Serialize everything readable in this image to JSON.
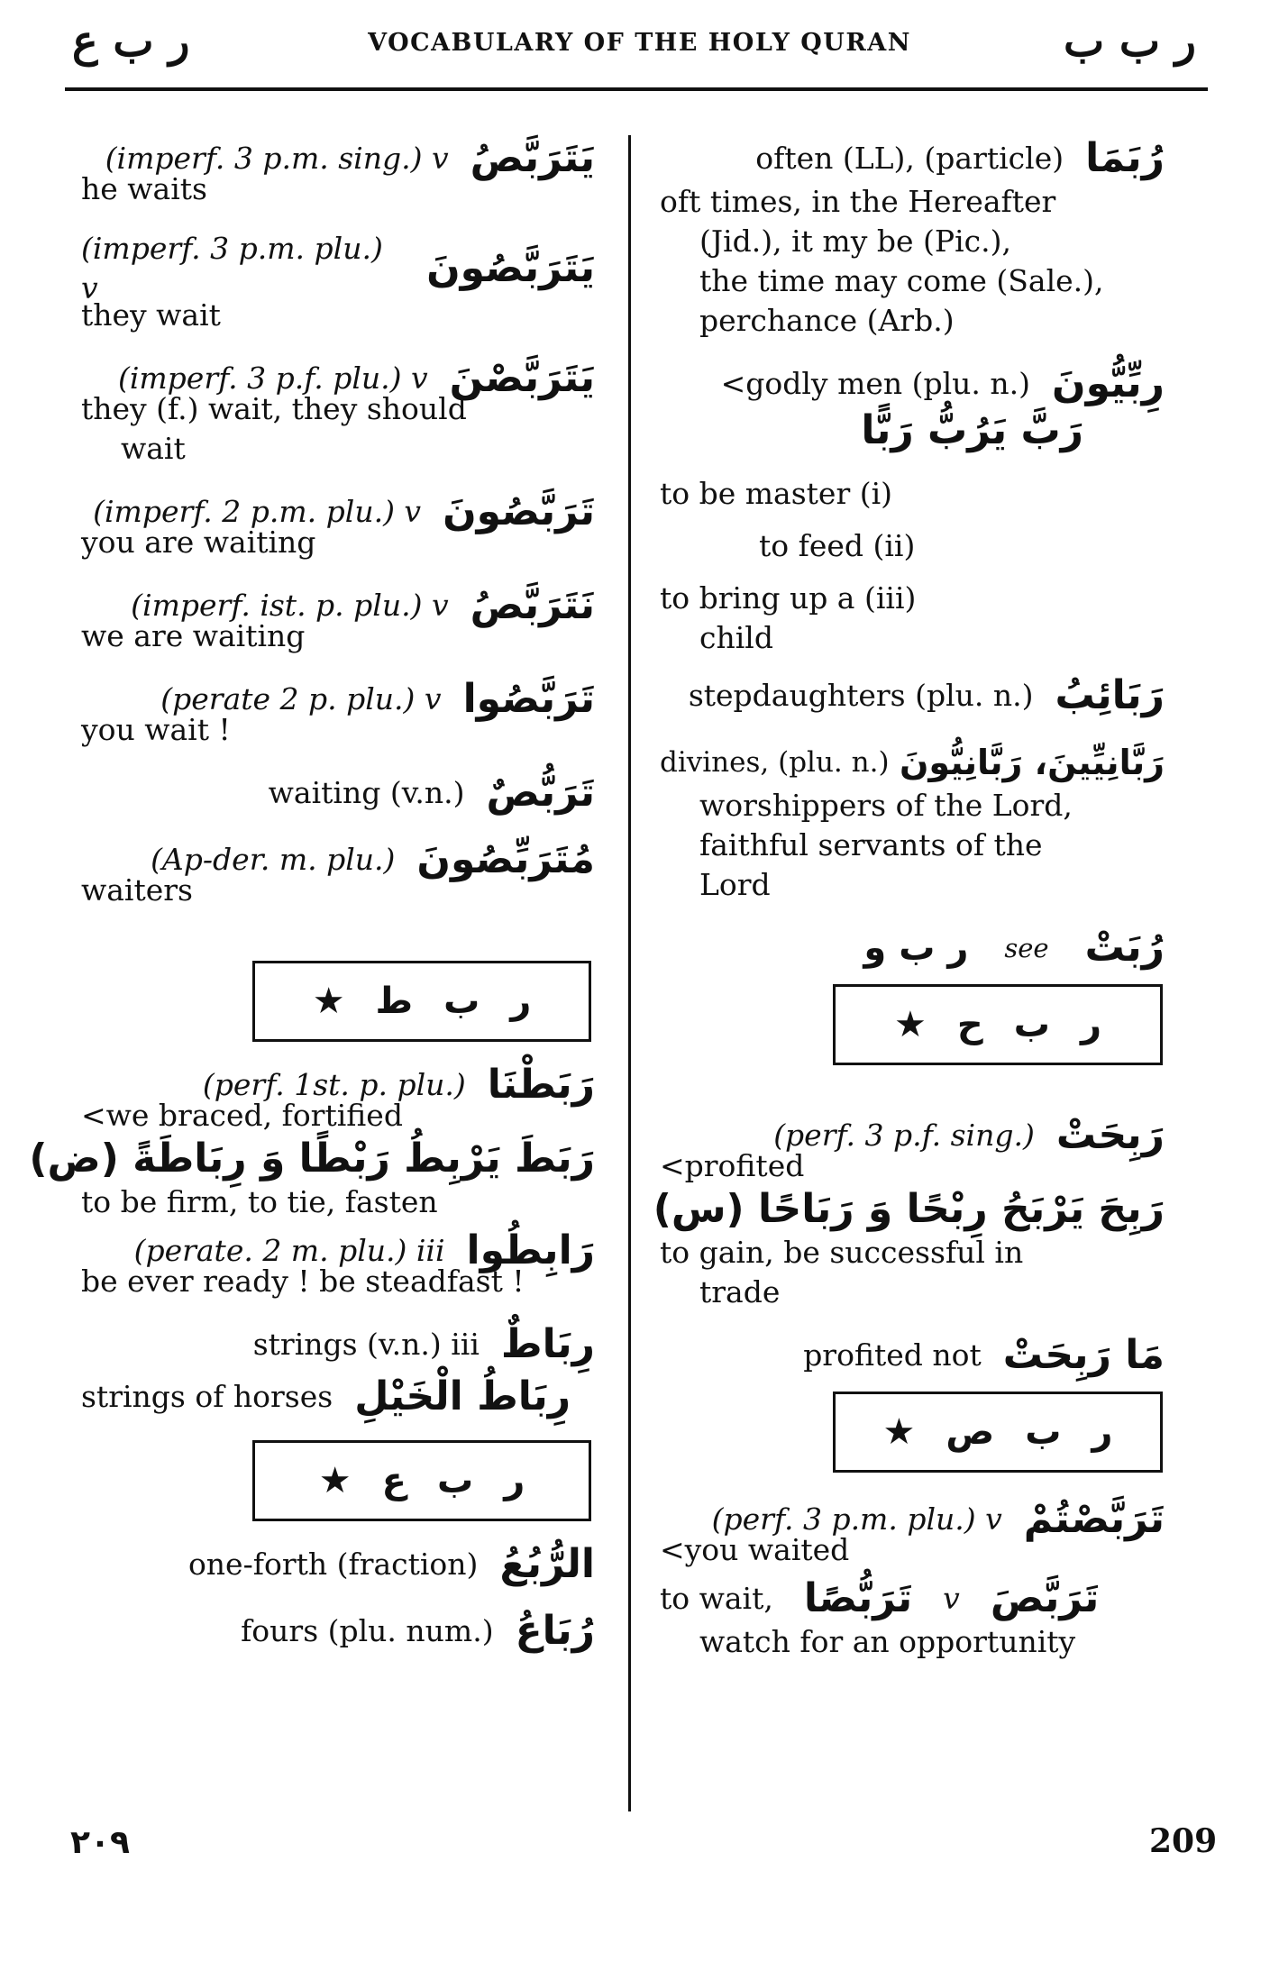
{
  "header": {
    "left_arabic": "ر ب ع",
    "title": "VOCABULARY OF THE HOLY QURAN",
    "right_arabic": "ر ب ب"
  },
  "left_column": {
    "entries": [
      {
        "ar": "يَتَرَبَّصُ",
        "gram": "(imperf. 3 p.m. sing.) v",
        "en": "he waits"
      },
      {
        "ar": "يَتَرَبَّصُونَ",
        "gram": "(imperf. 3 p.m. plu.) v",
        "en": "they wait"
      },
      {
        "ar": "يَتَرَبَّصْنَ",
        "gram": "(imperf. 3 p.f. plu.) v",
        "en": "they (f.) wait, they should",
        "en_cont": "wait"
      },
      {
        "ar": "تَرَبَّصُونَ",
        "gram": "(imperf. 2 p.m. plu.) v",
        "en": "you are waiting"
      },
      {
        "ar": "نَتَرَبَّصُ",
        "gram": "(imperf. ist. p. plu.) v",
        "en": "we are waiting"
      },
      {
        "ar": "تَرَبَّصُوا",
        "gram": "(perate 2 p. plu.) v",
        "en": "you wait !"
      },
      {
        "ar": "تَرَبُّصٌ",
        "gram": "waiting (v.n.)",
        "en": ""
      },
      {
        "ar": "مُتَرَبِّصُونَ",
        "gram": "(Ap-der. m. plu.)",
        "en": "waiters"
      }
    ],
    "root_box_1": {
      "letters": [
        "ر",
        "ب",
        "ط"
      ],
      "star": "★"
    },
    "entries2": {
      "e1": {
        "ar": "رَبَطْنَا",
        "gram": "(perf. 1st. p. plu.)",
        "en": "<we braced, fortified"
      },
      "verb_forms": "رَبَطَ يَرْبِطُ رَبْطًا وَ رِبَاطَةً (ض)",
      "verb_meaning": "to be firm, to tie, fasten",
      "e2": {
        "ar": "رَابِطُوا",
        "gram": "(perate. 2 m. plu.) iii",
        "en": "be ever ready ! be steadfast !"
      },
      "e3": {
        "ar": "رِبَاطٌ",
        "gram": "strings (v.n.) iii"
      },
      "e4": {
        "ar": "رِبَاطُ الْخَيْلِ",
        "gram": "strings of horses"
      }
    },
    "root_box_2": {
      "letters": [
        "ر",
        "ب",
        "ع"
      ],
      "star": "★"
    },
    "entries3": {
      "e1": {
        "ar": "الرُّبُعُ",
        "gram": "one-forth (fraction)"
      },
      "e2": {
        "ar": "رُبَاعُ",
        "gram": "fours (plu. num.)"
      }
    }
  },
  "right_column": {
    "e1": {
      "ar": "رُبَمَا",
      "gram": "often (LL), (particle)",
      "en": "oft times, in the Hereafter",
      "en_cont": [
        "(Jid.), it my be (Pic.),",
        "the time may come (Sale.),",
        "perchance (Arb.)"
      ]
    },
    "e2": {
      "ar": "رِبِّيُّونَ",
      "gram": "<godly men (plu. n.)",
      "verb_forms": "رَبَّ يَرُبُّ رَبًّا"
    },
    "meanings": [
      "to be master (i)",
      "to feed (ii)",
      "to bring up a (iii)",
      "child"
    ],
    "e3": {
      "ar": "رَبَائِبُ",
      "gram": "stepdaughters (plu. n.)"
    },
    "e4": {
      "ar": "رَبَّانِيِّينَ، رَبَّانِيُّونَ",
      "gram": "divines, (plu. n.)",
      "en_cont": [
        "worshippers of the Lord,",
        "faithful servants of the",
        "Lord"
      ]
    },
    "e5": {
      "ar": "رُبَتْ",
      "gram": "see",
      "see_ref": "ر ب و"
    },
    "root_box_1": {
      "letters": [
        "ر",
        "ب",
        "ح"
      ],
      "star": "★"
    },
    "e6": {
      "ar": "رَبِحَتْ",
      "gram": "(perf. 3 p.f. sing.)",
      "en": "<profited",
      "verb_forms": "رَبِحَ يَرْبَحُ رِبْحًا وَ رَبَاحًا (س)",
      "meaning": "to gain, be successful in",
      "meaning_cont": "trade"
    },
    "e7": {
      "ar": "مَا رَبِحَتْ",
      "gram": "profited not"
    },
    "root_box_2": {
      "letters": [
        "ر",
        "ب",
        "ص"
      ],
      "star": "★"
    },
    "e8": {
      "ar": "تَرَبَّصْتُمْ",
      "gram": "(perf. 3 p.m. plu.) v",
      "en": "<you waited",
      "line2_en": "to wait,",
      "line2_ar1": "تَرَبُّصًا",
      "line2_v": "v",
      "line2_ar2": "تَرَبَّصَ",
      "meaning": "watch for an opportunity"
    }
  },
  "footer": {
    "left_arabic_page": "٢٠٩",
    "right_page": "209"
  }
}
